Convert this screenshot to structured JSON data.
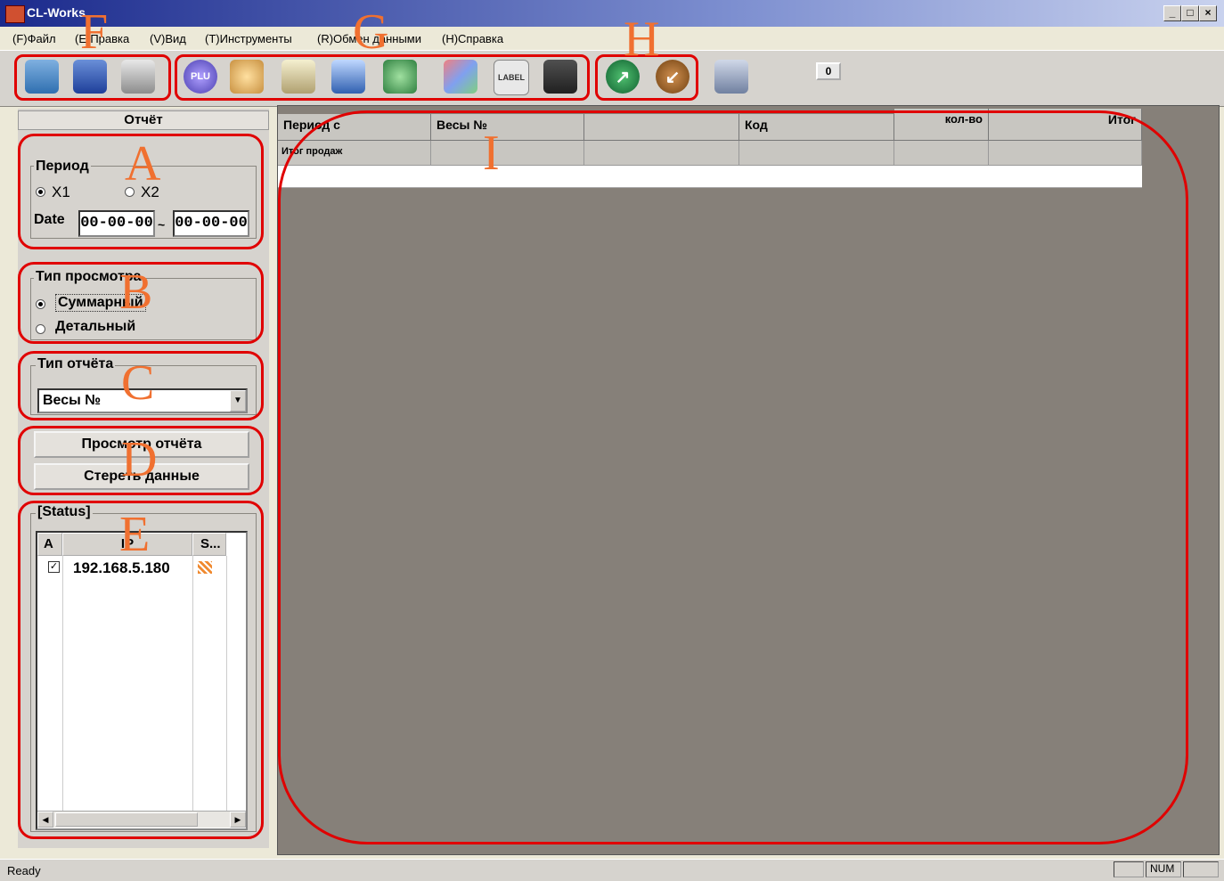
{
  "window": {
    "title": "CL-Works",
    "minimize": "_",
    "restore": "□",
    "close": "×"
  },
  "menu": [
    "(F)Файл",
    "(E)Правка",
    "(V)Вид",
    "(T)Инструменты",
    "(R)Обмен данными",
    "(H)Справка"
  ],
  "toolbar": {
    "file_icons": [
      "open-folder-icon",
      "save-disk-icon",
      "print-icon"
    ],
    "data_icons": [
      "plu-icon",
      "star-icon",
      "scale-icon",
      "scale-2-icon",
      "group-icon",
      "palette-icon",
      "label-icon",
      "keyboard-icon"
    ],
    "plu_text": "PLU",
    "label_text": "LABEL",
    "transfer_icons": [
      "send-icon",
      "receive-icon"
    ],
    "settings_icon": "wrench-icon",
    "counter": "0"
  },
  "callouts": {
    "A": "A",
    "B": "B",
    "C": "C",
    "D": "D",
    "E": "E",
    "F": "F",
    "G": "G",
    "H": "H",
    "I": "I"
  },
  "panel": {
    "title": "Отчёт",
    "period": {
      "label": "Период",
      "option1": "X1",
      "option2": "X2",
      "selected": "X1",
      "date_label": "Date",
      "date_from": "00-00-00",
      "date_sep": "~",
      "date_to": "00-00-00"
    },
    "view_type": {
      "label": "Тип просмотра",
      "option1": "Суммарный",
      "option2": "Детальный",
      "selected": "Суммарный"
    },
    "report_type": {
      "label": "Тип отчёта",
      "selected": "Весы №"
    },
    "view_report_button": "Просмотр отчёта",
    "clear_data_button": "Стереть данные",
    "status": {
      "label": "[Status]",
      "columns": [
        "A",
        "IP",
        "S..."
      ],
      "rows": [
        {
          "checked": true,
          "ip": "192.168.5.180"
        }
      ]
    }
  },
  "grid": {
    "columns": [
      "Период c",
      "Весы №",
      "",
      "Код",
      "кол-во",
      "Итог"
    ],
    "rows": [
      [
        "Итог продаж",
        "",
        "",
        "",
        "",
        ""
      ]
    ]
  },
  "statusbar": {
    "text": "Ready",
    "num": "NUM"
  },
  "colors": {
    "callout_border": "#e00000",
    "callout_letter": "#f07030",
    "title_bar": "#1b2a8c",
    "workspace": "#868079"
  }
}
